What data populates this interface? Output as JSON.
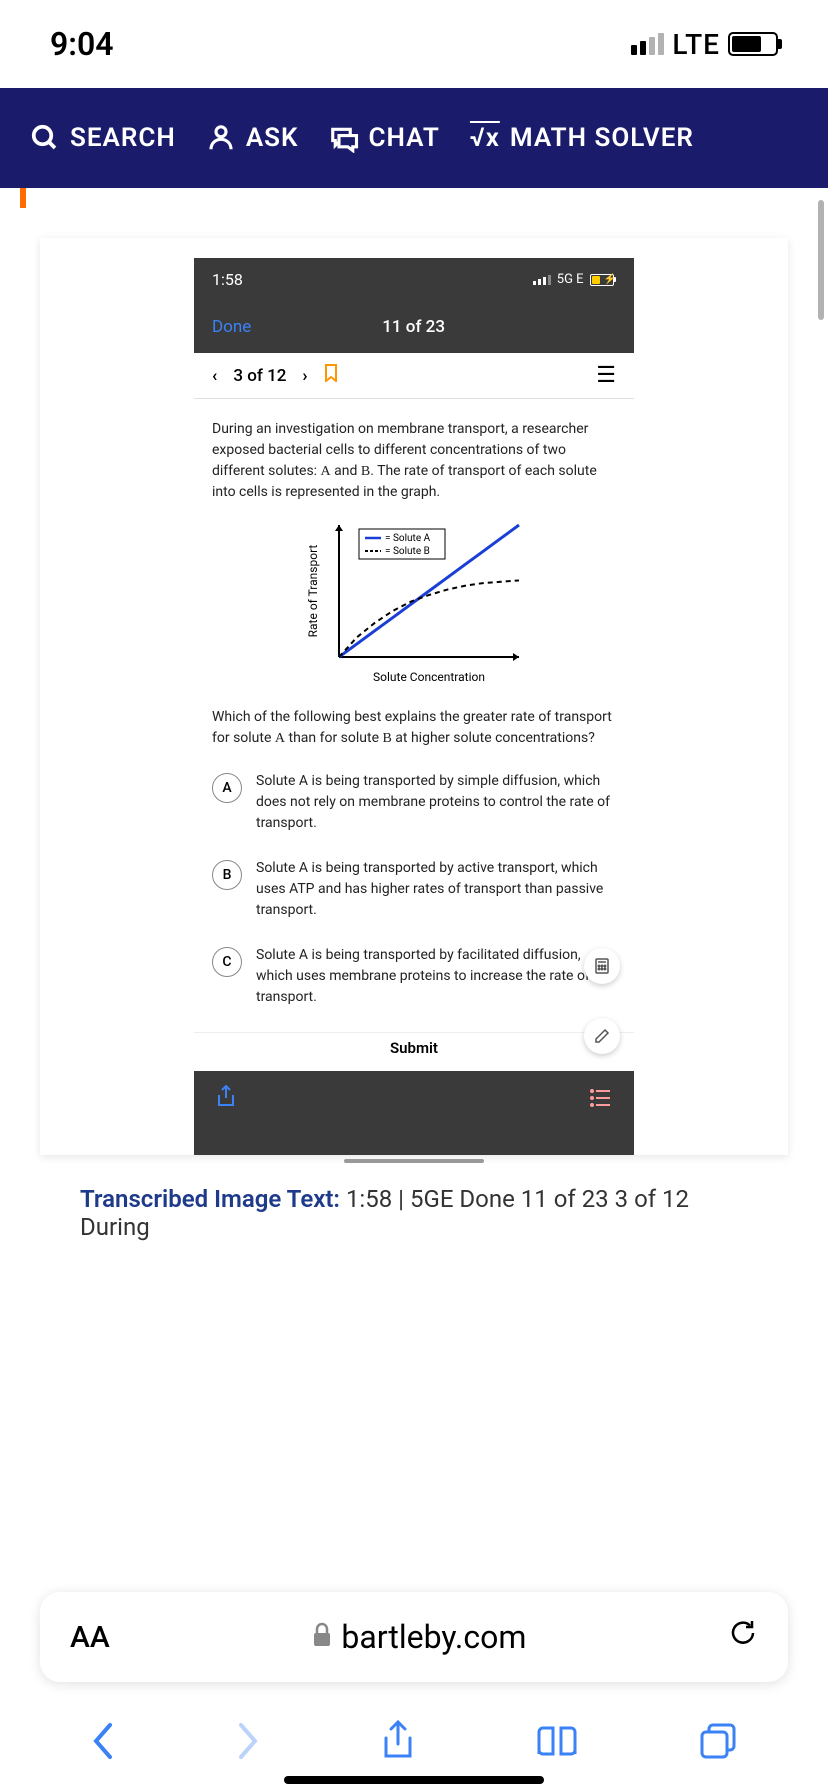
{
  "status": {
    "time": "9:04",
    "network": "LTE"
  },
  "nav": {
    "search": "SEARCH",
    "ask": "ASK",
    "chat": "CHAT",
    "math": "MATH SOLVER",
    "math_prefix": "√x"
  },
  "inner": {
    "status_time": "1:58",
    "status_net": "5G E",
    "done": "Done",
    "page_of": "11 of 23",
    "step_of": "3 of 12",
    "question_p1": "During an investigation on membrane transport, a researcher exposed bacterial cells to different concentrations of two different solutes: ",
    "question_a": "A",
    "question_and": " and ",
    "question_b": "B",
    "question_p1b": ". The rate of transport of each solute into cells is represented in the graph.",
    "question_p2a": "Which of the following best explains the greater rate of transport for solute ",
    "question_p2b": " than for solute ",
    "question_p2c": " at higher solute concentrations?",
    "legend_a": "= Solute A",
    "legend_b": "= Solute B",
    "ylabel": "Rate of Transport",
    "xlabel": "Solute Concentration",
    "choices": {
      "A": "Solute A is being transported by simple diffusion, which does not rely on membrane proteins to control the rate of transport.",
      "B": "Solute A is being transported by active transport, which uses ATP and has higher rates of transport than passive transport.",
      "C": "Solute A is being transported by facilitated diffusion, which uses membrane proteins to increase the rate of transport."
    },
    "submit": "Submit"
  },
  "transcribed": {
    "label": "Transcribed Image Text:",
    "text": "1:58 | 5GE Done 11 of 23 3 of 12 During"
  },
  "safari": {
    "aa": "AA",
    "url": "bartleby.com"
  },
  "chart_data": {
    "type": "line",
    "title": "",
    "xlabel": "Solute Concentration",
    "ylabel": "Rate of Transport",
    "x": [
      0,
      1,
      2,
      3,
      4,
      5,
      6,
      7,
      8,
      9,
      10
    ],
    "series": [
      {
        "name": "Solute A",
        "style": "solid",
        "color": "#1a3fd6",
        "values": [
          0,
          1,
          2,
          3,
          4,
          5,
          6,
          7,
          8,
          9,
          10
        ]
      },
      {
        "name": "Solute B",
        "style": "dashed",
        "color": "#000000",
        "values": [
          0,
          1.5,
          2.6,
          3.5,
          4.2,
          4.7,
          5.1,
          5.4,
          5.6,
          5.7,
          5.8
        ]
      }
    ],
    "xlim": [
      0,
      10
    ],
    "ylim": [
      0,
      10
    ]
  }
}
